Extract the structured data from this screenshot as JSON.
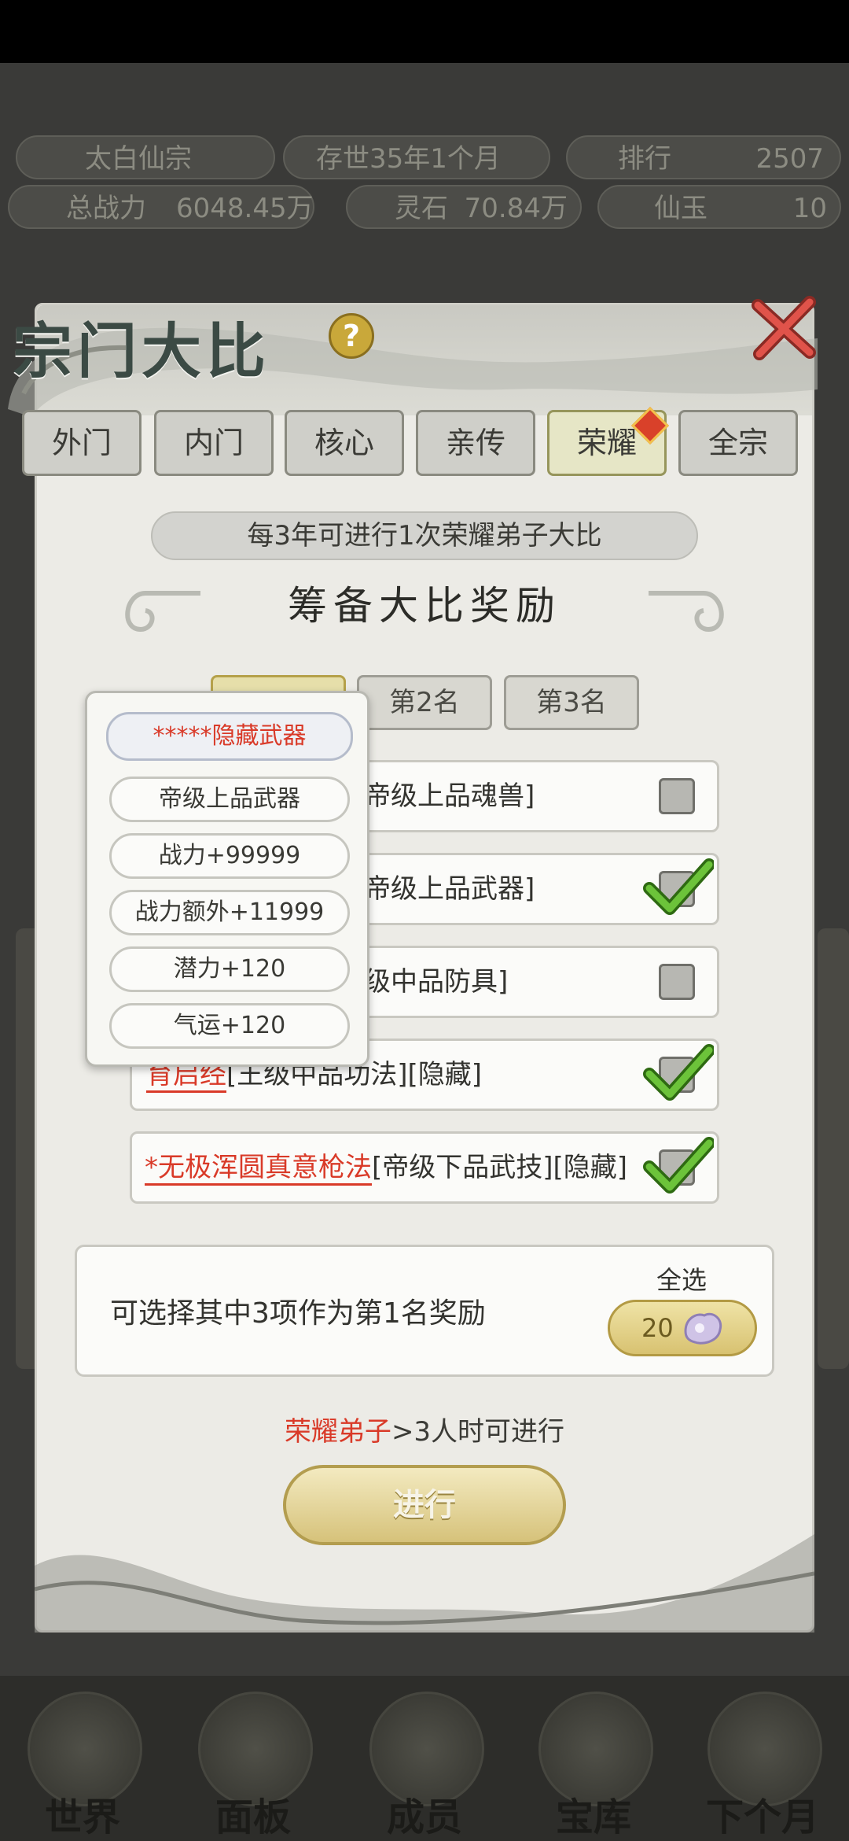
{
  "top_bar": {
    "sect_name": "太白仙宗",
    "age": "存世35年1个月",
    "rank_label": "排行",
    "rank_value": "2507",
    "power_label": "总战力",
    "power_value": "6048.45万",
    "spirit_stone_label": "灵石",
    "spirit_stone_value": "70.84万",
    "jade_label": "仙玉",
    "jade_value": "10"
  },
  "dialog": {
    "title": "宗门大比",
    "help_symbol": "?",
    "tabs": [
      {
        "label": "外门",
        "active": false
      },
      {
        "label": "内门",
        "active": false
      },
      {
        "label": "核心",
        "active": false
      },
      {
        "label": "亲传",
        "active": false
      },
      {
        "label": "荣耀",
        "active": true
      },
      {
        "label": "全宗",
        "active": false
      }
    ],
    "notice": "每3年可进行1次荣耀弟子大比",
    "section_title": "筹备大比奖励",
    "rank_tabs": [
      {
        "label": "",
        "selected": true
      },
      {
        "label": "第2名",
        "selected": false
      },
      {
        "label": "第3名",
        "selected": false
      }
    ],
    "rewards": [
      {
        "highlight": "",
        "text": "帝级上品魂兽]",
        "checked": false
      },
      {
        "highlight": "",
        "text": "帝级上品武器]",
        "checked": true
      },
      {
        "highlight": "",
        "text": "级中品防具]",
        "checked": false
      },
      {
        "highlight": "育启经",
        "text": "[王级中品功法][隐藏]",
        "checked": true
      },
      {
        "highlight": "*无极浑圆真意枪法",
        "text": "[帝级下品武技][隐藏]",
        "checked": true
      }
    ],
    "dropdown": [
      "*****隐藏武器",
      "帝级上品武器",
      "战力+99999",
      "战力额外+11999",
      "潜力+120",
      "气运+120"
    ],
    "select_desc": "可选择其中3项作为第1名奖励",
    "select_all_label": "全选",
    "select_all_cost": "20",
    "requirement_red": "荣耀弟子",
    "requirement_rest": ">3人时可进行",
    "proceed_label": "进行"
  },
  "bottom_nav": [
    {
      "label": "世界"
    },
    {
      "label": "面板"
    },
    {
      "label": "成员"
    },
    {
      "label": "宝库"
    },
    {
      "label": "下个月"
    }
  ],
  "colors": {
    "accent_red": "#d93a28",
    "gold": "#d6c27a",
    "check_green": "#5fb82f"
  }
}
